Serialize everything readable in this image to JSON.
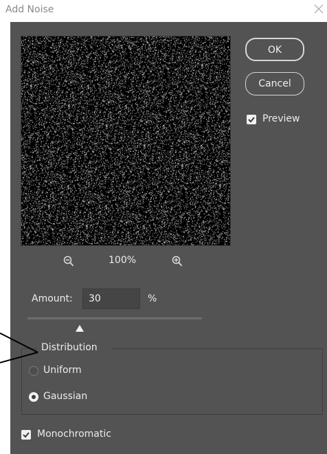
{
  "window": {
    "title": "Add Noise",
    "close_icon": "close-icon"
  },
  "buttons": {
    "ok": "OK",
    "cancel": "Cancel"
  },
  "preview_option": {
    "label": "Preview",
    "checked": true
  },
  "zoom": {
    "level": "100%",
    "zoom_out_icon": "zoom-out-icon",
    "zoom_in_icon": "zoom-in-icon"
  },
  "amount": {
    "label": "Amount:",
    "value": "30",
    "unit": "%",
    "slider_fraction": 0.3
  },
  "distribution": {
    "legend": "Distribution",
    "options": [
      {
        "label": "Uniform",
        "selected": false
      },
      {
        "label": "Gaussian",
        "selected": true
      }
    ]
  },
  "monochromatic": {
    "label": "Monochromatic",
    "checked": true
  },
  "colors": {
    "background": "#535353",
    "preview_bg": "#000000"
  }
}
